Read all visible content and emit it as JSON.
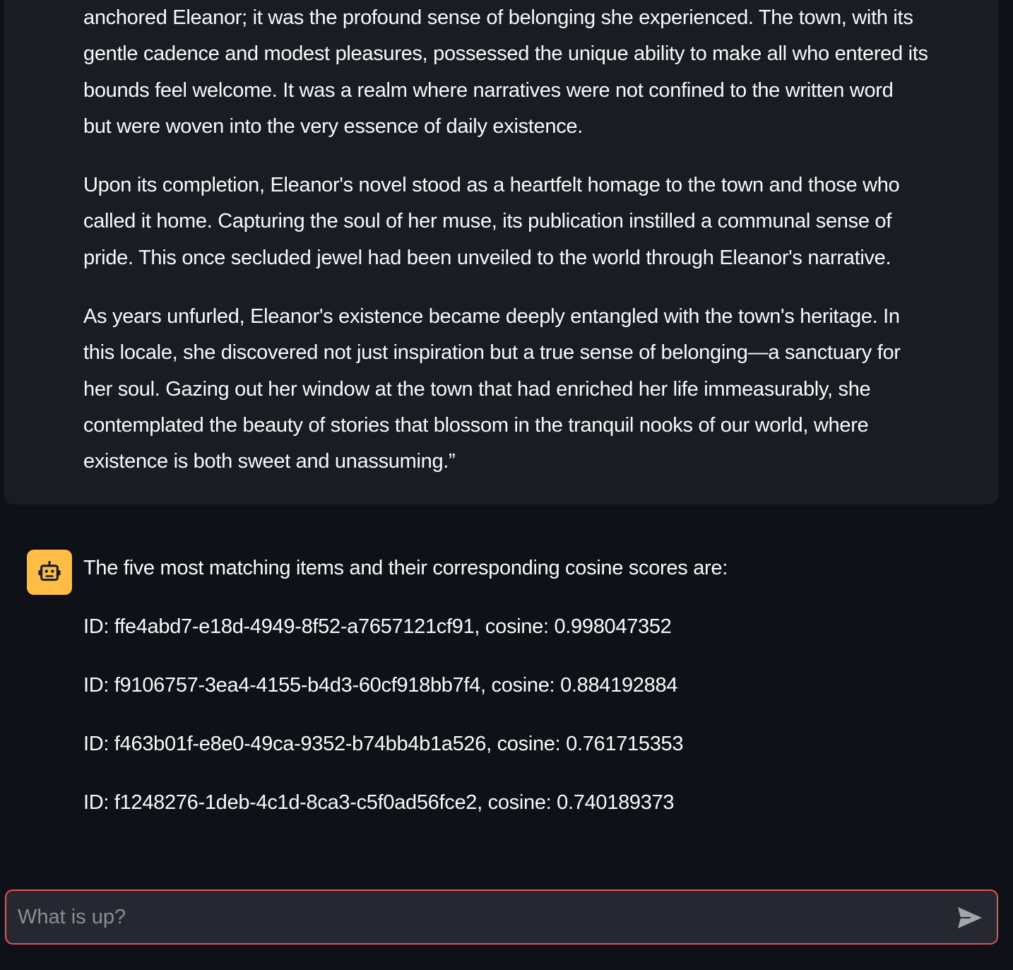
{
  "user_message": {
    "paragraphs": [
      [
        "anchored Eleanor; it was the profound sense of belonging she experienced. The town, with its",
        "gentle cadence and modest pleasures, possessed the unique ability to make all who entered its",
        "bounds feel welcome. It was a realm where narratives were not confined to the written word",
        "but were woven into the very essence of daily existence."
      ],
      [
        "Upon its completion, Eleanor's novel stood as a heartfelt homage to the town and those who",
        "called it home. Capturing the soul of her muse, its publication instilled a communal sense of",
        "pride. This once secluded jewel had been unveiled to the world through Eleanor's narrative."
      ],
      [
        "As years unfurled, Eleanor's existence became deeply entangled with the town's heritage. In",
        "this locale, she discovered not just inspiration but a true sense of belonging—a sanctuary for",
        "her soul. Gazing out her window at the town that had enriched her life immeasurably, she",
        "contemplated the beauty of stories that blossom in the tranquil nooks of our world, where",
        "existence is both sweet and unassuming.”"
      ]
    ]
  },
  "assistant_message": {
    "avatar_icon": "robot-icon",
    "avatar_color": "#ffbd45",
    "intro": "The five most matching items and their corresponding cosine scores are:",
    "results": [
      "ID: ffe4abd7-e18d-4949-8f52-a7657121cf91, cosine: 0.998047352",
      "ID: f9106757-3ea4-4155-b4d3-60cf918bb7f4, cosine: 0.884192884",
      "ID: f463b01f-e8e0-49ca-9352-b74bb4b1a526, cosine: 0.761715353",
      "ID: f1248276-1deb-4c1d-8ca3-c5f0ad56fce2, cosine: 0.740189373"
    ]
  },
  "chat_input": {
    "placeholder": "What is up?",
    "value": "",
    "send_icon": "send-icon",
    "border_color": "#e8534e"
  }
}
